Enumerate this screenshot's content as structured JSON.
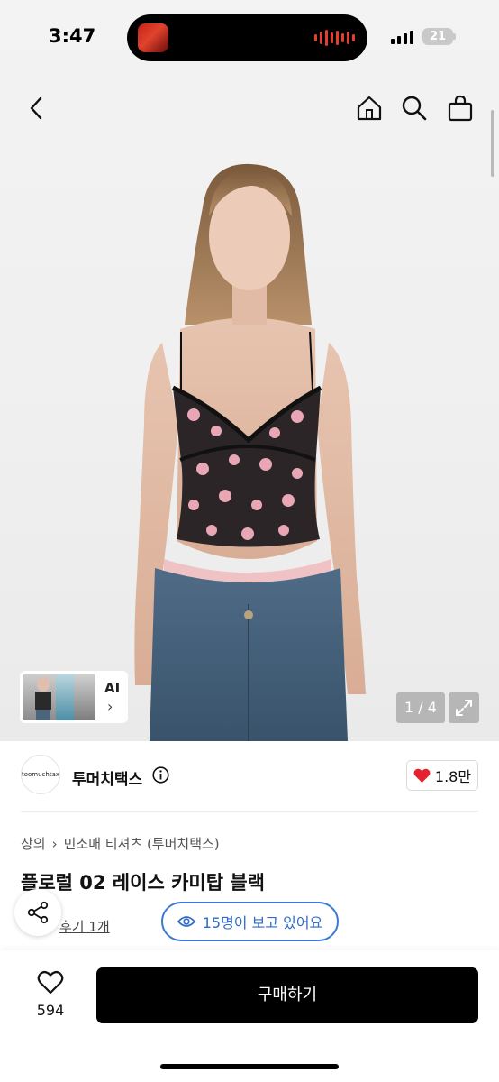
{
  "status_bar": {
    "time": "3:47",
    "battery": "21"
  },
  "gallery": {
    "ai_label": "AI",
    "page_indicator": "1 / 4"
  },
  "seller": {
    "logo_text": "toomuchtax",
    "name": "투머치택스",
    "likes": "1.8만"
  },
  "breadcrumb": [
    "상의",
    "민소매 티셔츠 (투머치택스)"
  ],
  "product": {
    "title": "플로럴 02 레이스 카미탑 블랙",
    "reviews": "후기 1개",
    "viewers": "15명이 보고 있어요"
  },
  "bottom_bar": {
    "wishlist_count": "594",
    "buy_label": "구매하기"
  },
  "colors": {
    "accent_blue": "#3d79d4",
    "heart_red": "#e5222d",
    "black": "#000000"
  }
}
